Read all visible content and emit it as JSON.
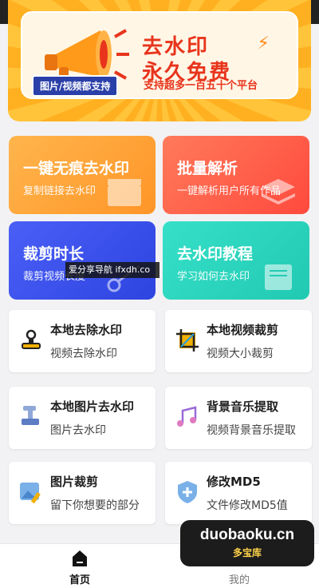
{
  "banner": {
    "title_line1": "去水印",
    "title_line2": "永久免费",
    "tag_support": "图片/视频都支持",
    "tag_platforms": "支持超多一百五十个平台"
  },
  "feature_cards": [
    {
      "title": "一键无痕去水印",
      "subtitle": "复制链接去水印"
    },
    {
      "title": "批量解析",
      "subtitle": "一键解析用户所有作品"
    },
    {
      "title": "裁剪时长",
      "subtitle": "裁剪视频长度"
    },
    {
      "title": "去水印教程",
      "subtitle": "学习如何去水印"
    }
  ],
  "overlay_watermark": "爱分享导航 ifxdh.co",
  "tools": [
    {
      "title": "本地去除水印",
      "subtitle": "视频去除水印",
      "icon": "stamp-icon"
    },
    {
      "title": "本地视频裁剪",
      "subtitle": "视频大小裁剪",
      "icon": "crop-icon"
    },
    {
      "title": "本地图片去水印",
      "subtitle": "图片去水印",
      "icon": "image-stamp-icon"
    },
    {
      "title": "背景音乐提取",
      "subtitle": "视频背景音乐提取",
      "icon": "music-icon"
    },
    {
      "title": "图片裁剪",
      "subtitle": "留下你想要的部分",
      "icon": "image-edit-icon"
    },
    {
      "title": "修改MD5",
      "subtitle": "文件修改MD5值",
      "icon": "shield-icon"
    }
  ],
  "site_watermark": {
    "domain": "duobaoku.cn",
    "name": "多宝库"
  },
  "bottom_nav": {
    "home": "首页",
    "mine": "我的"
  }
}
